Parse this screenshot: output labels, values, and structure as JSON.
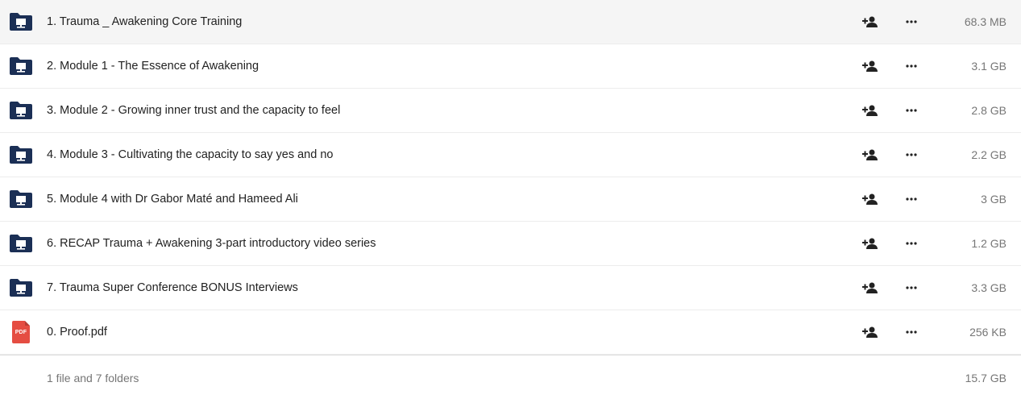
{
  "colors": {
    "folder": "#1b2f55",
    "pdf": "#e54d42",
    "icon": "#222222",
    "muted": "#767676"
  },
  "items": [
    {
      "name": "1. Trauma _ Awakening Core Training",
      "size": "68.3 MB",
      "type": "folder",
      "icon": "shared-folder-icon"
    },
    {
      "name": "2. Module 1 - The Essence of Awakening",
      "size": "3.1 GB",
      "type": "folder",
      "icon": "shared-folder-icon"
    },
    {
      "name": "3. Module 2 - Growing inner trust and the capacity to feel",
      "size": "2.8 GB",
      "type": "folder",
      "icon": "shared-folder-icon"
    },
    {
      "name": "4. Module 3 - Cultivating the capacity to say yes and no",
      "size": "2.2 GB",
      "type": "folder",
      "icon": "shared-folder-icon"
    },
    {
      "name": "5. Module 4 with Dr Gabor Maté and Hameed Ali",
      "size": "3 GB",
      "type": "folder",
      "icon": "shared-folder-icon"
    },
    {
      "name": "6. RECAP Trauma + Awakening 3-part introductory video series",
      "size": "1.2 GB",
      "type": "folder",
      "icon": "shared-folder-icon"
    },
    {
      "name": "7. Trauma Super Conference BONUS Interviews",
      "size": "3.3 GB",
      "type": "folder",
      "icon": "shared-folder-icon"
    },
    {
      "name": "0. Proof.pdf",
      "size": "256 KB",
      "type": "pdf",
      "icon": "pdf-file-icon",
      "badge": "PDF"
    }
  ],
  "summary": {
    "text": "1 file and 7 folders",
    "total_size": "15.7 GB"
  }
}
